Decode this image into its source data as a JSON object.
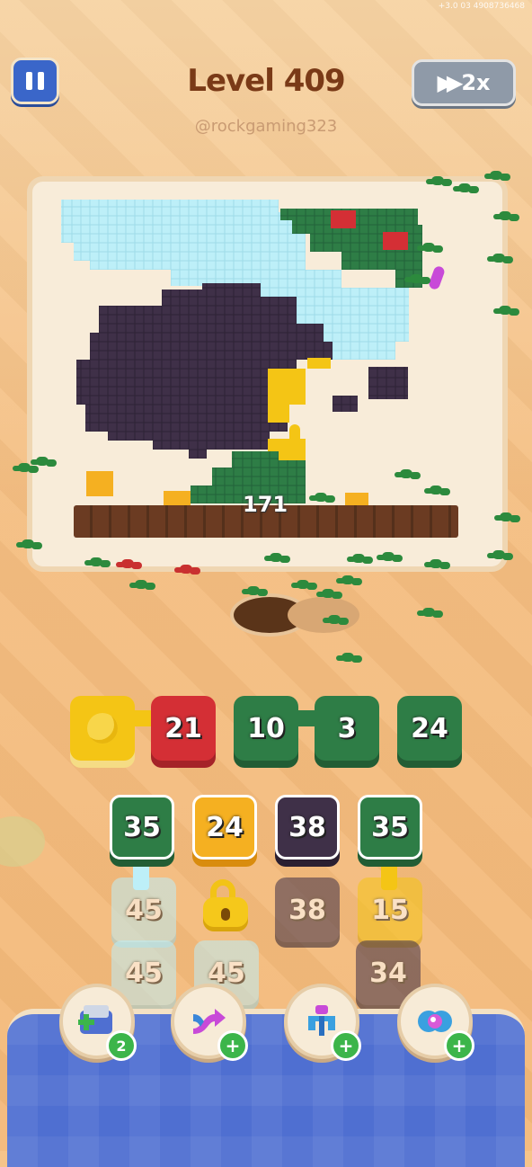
{
  "status": {
    "text": "+3.0 03   4908736468"
  },
  "header": {
    "title": "Level 409",
    "subtitle": "@rockgaming323",
    "speed_label": "2x"
  },
  "board": {
    "remaining_count": "171",
    "colors": {
      "light_blue": "#bdeff8",
      "dark_purple": "#3f3048",
      "green": "#2e7d46",
      "red": "#d42f35",
      "yellow": "#f4c515",
      "orange": "#f5b021"
    }
  },
  "queue_slots": [
    {
      "color": "yellow",
      "label": ""
    },
    {
      "color": "red",
      "label": "21"
    },
    {
      "color": "green",
      "label": "10"
    },
    {
      "color": "green",
      "label": "3"
    },
    {
      "color": "green",
      "label": "24"
    }
  ],
  "grid": {
    "row1": [
      {
        "color": "green",
        "label": "35"
      },
      {
        "color": "orange",
        "label": "24"
      },
      {
        "color": "dark",
        "label": "38"
      },
      {
        "color": "green",
        "label": "35"
      }
    ],
    "row2": [
      {
        "color": "light_blue",
        "label": "45"
      },
      {
        "color": "locked",
        "label": ""
      },
      {
        "color": "dark",
        "label": "38"
      },
      {
        "color": "yellow",
        "label": "15"
      }
    ],
    "row3": [
      {
        "color": "light_blue",
        "label": "45"
      },
      {
        "color": "light_blue",
        "label": "45"
      },
      {
        "color": "dark",
        "label": "34"
      }
    ]
  },
  "boosters": [
    {
      "name": "add-slot",
      "badge": "2"
    },
    {
      "name": "shuffle",
      "badge": "+"
    },
    {
      "name": "magnet",
      "badge": "+"
    },
    {
      "name": "bomb",
      "badge": "+"
    }
  ]
}
